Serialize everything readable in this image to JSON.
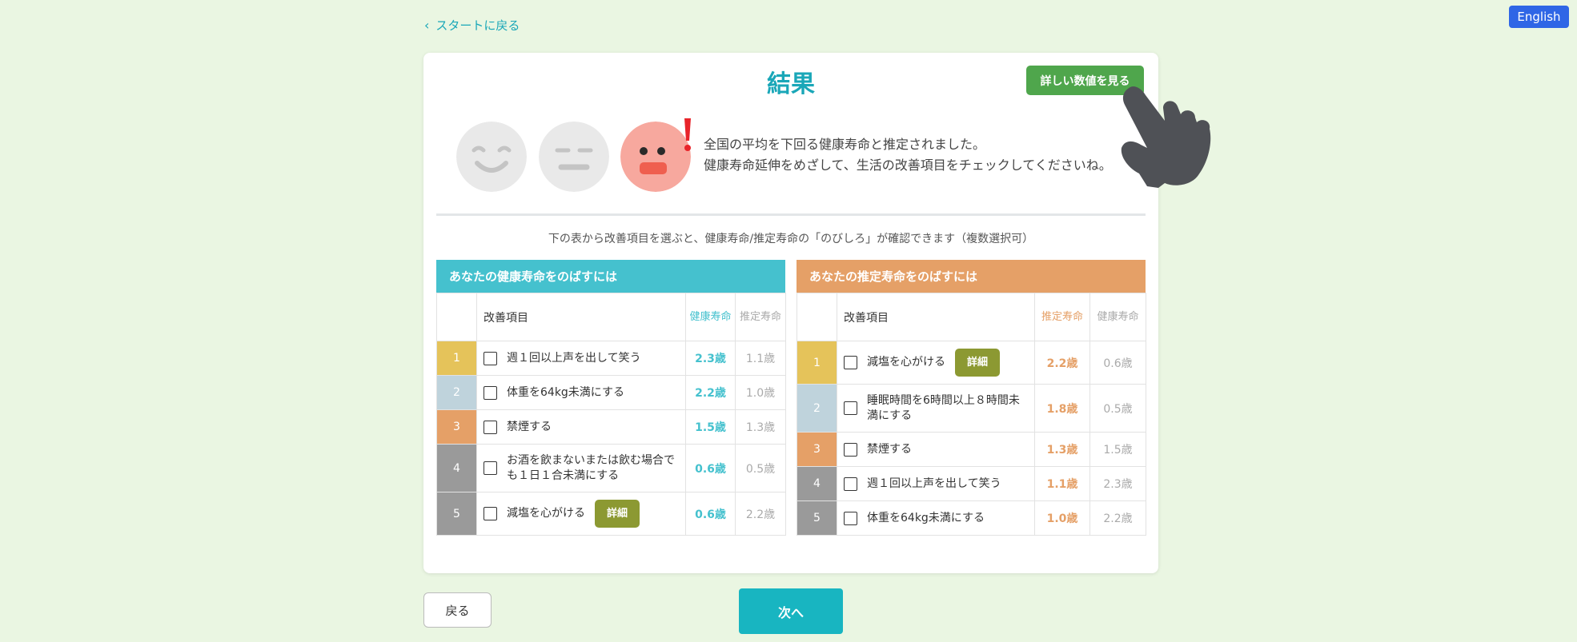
{
  "header": {
    "language_label": "English",
    "back_to_start": "スタートに戻る"
  },
  "result": {
    "title": "結果",
    "detail_button": "詳しい数値を見る",
    "message_line1": "全国の平均を下回る健康寿命と推定されました。",
    "message_line2": "健康寿命延伸をめざして、生活の改善項目をチェックしてくださいね。",
    "instruction": "下の表から改善項目を選ぶと、健康寿命/推定寿命の「のびしろ」が確認できます（複数選択可）",
    "face_icons": [
      "smile-face-icon",
      "neutral-face-icon",
      "worried-face-icon"
    ]
  },
  "health_table": {
    "header": "あなたの健康寿命をのばすには",
    "col_item": "改善項目",
    "col_primary": "健康寿命",
    "col_secondary": "推定寿命",
    "rows": [
      {
        "rank": "1",
        "item": "週１回以上声を出して笑う",
        "v1": "2.3歳",
        "v2": "1.1歳",
        "color": "#e5c35a"
      },
      {
        "rank": "2",
        "item": "体重を64kg未満にする",
        "v1": "2.2歳",
        "v2": "1.0歳",
        "color": "#bfd3dc"
      },
      {
        "rank": "3",
        "item": "禁煙する",
        "v1": "1.5歳",
        "v2": "1.3歳",
        "color": "#e5a067"
      },
      {
        "rank": "4",
        "item": "お酒を飲まないまたは飲む場合でも１日１合未満にする",
        "v1": "0.6歳",
        "v2": "0.5歳",
        "color": "#9a9a9a"
      },
      {
        "rank": "5",
        "item": "減塩を心がける",
        "detail": "詳細",
        "v1": "0.6歳",
        "v2": "2.2歳",
        "color": "#9a9a9a"
      }
    ]
  },
  "lifespan_table": {
    "header": "あなたの推定寿命をのばすには",
    "col_item": "改善項目",
    "col_primary": "推定寿命",
    "col_secondary": "健康寿命",
    "rows": [
      {
        "rank": "1",
        "item": "減塩を心がける",
        "detail": "詳細",
        "v1": "2.2歳",
        "v2": "0.6歳",
        "color": "#e5c35a"
      },
      {
        "rank": "2",
        "item": "睡眠時間を6時間以上８時間未満にする",
        "v1": "1.8歳",
        "v2": "0.5歳",
        "color": "#bfd3dc"
      },
      {
        "rank": "3",
        "item": "禁煙する",
        "v1": "1.3歳",
        "v2": "1.5歳",
        "color": "#e5a067"
      },
      {
        "rank": "4",
        "item": "週１回以上声を出して笑う",
        "v1": "1.1歳",
        "v2": "2.3歳",
        "color": "#9a9a9a"
      },
      {
        "rank": "5",
        "item": "体重を64kg未満にする",
        "v1": "1.0歳",
        "v2": "2.2歳",
        "color": "#9a9a9a"
      }
    ]
  },
  "footer": {
    "back_label": "戻る",
    "next_label": "次へ"
  }
}
